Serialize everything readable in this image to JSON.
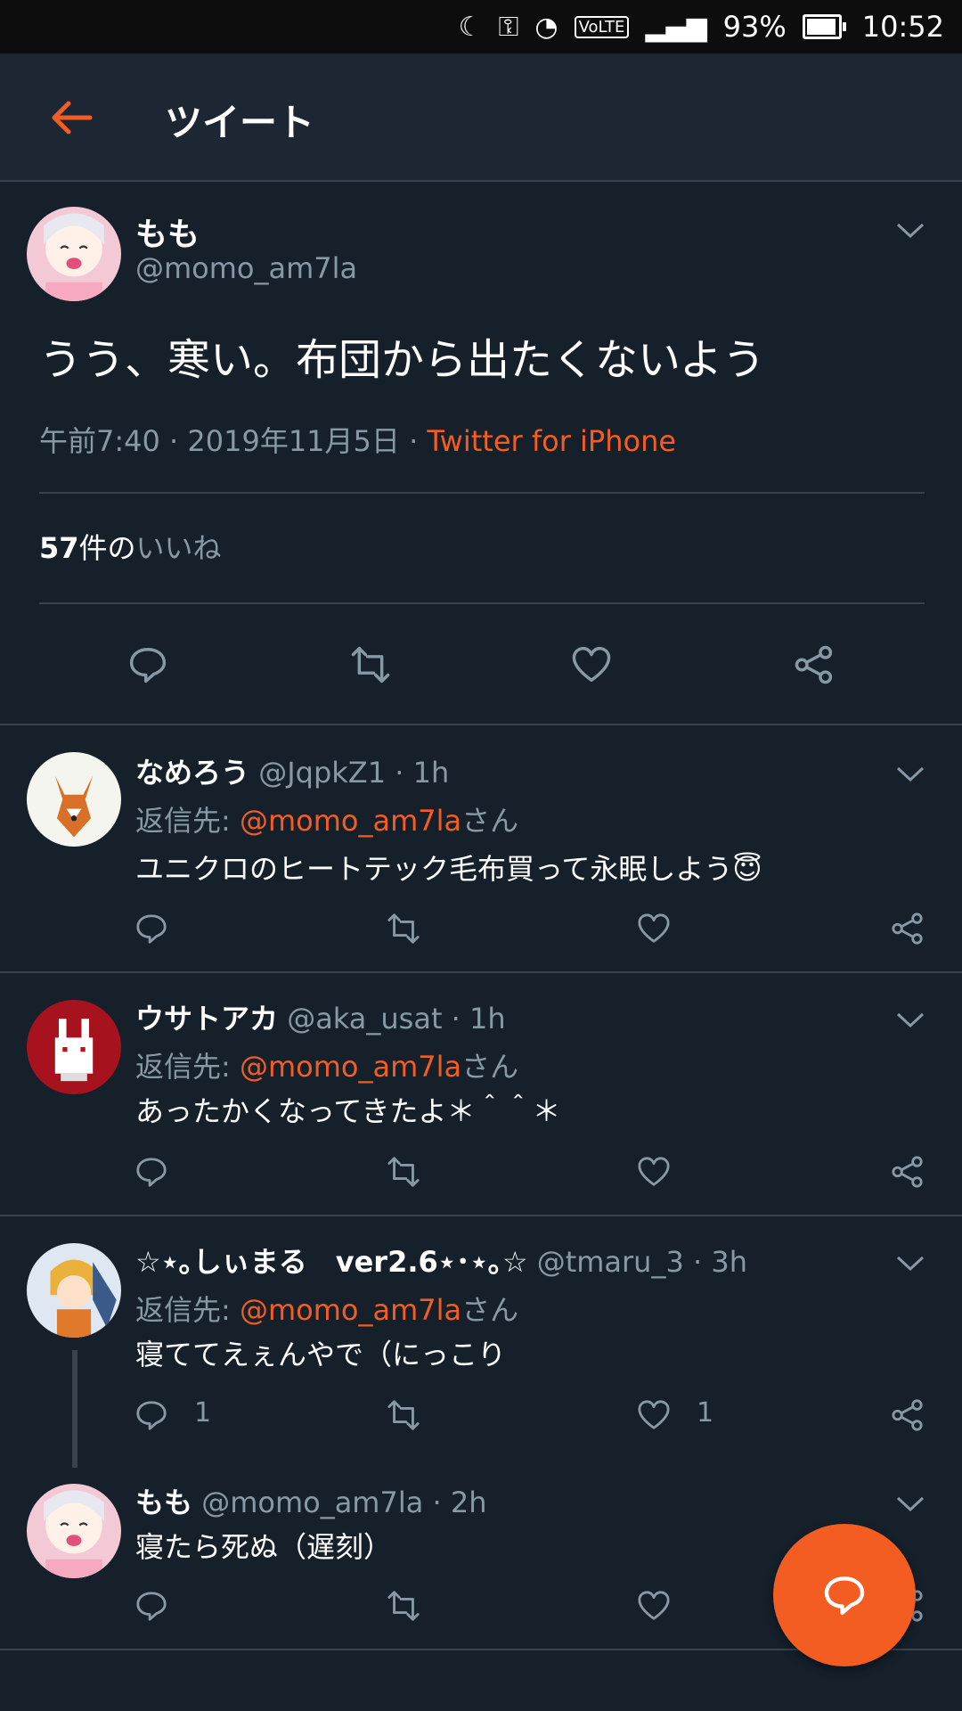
{
  "status_bar": {
    "battery": "93%",
    "time": "10:52"
  },
  "header": {
    "title": "ツイート"
  },
  "main_tweet": {
    "name": "もも",
    "handle": "@momo_am7la",
    "text": "うう、寒い。布団から出たくないよう",
    "time": "午前7:40 · 2019年11月5日 ·",
    "source": "Twitter for iPhone",
    "likes_count": "57",
    "likes_suffix": "件の",
    "likes_label": "いいね"
  },
  "replies": [
    {
      "name": "なめろう",
      "handle": "@JqpkZ1",
      "time": "1h",
      "reply_prefix": "返信先: ",
      "reply_to": "@momo_am7la",
      "reply_suffix": "さん",
      "text": "ユニクロのヒートテック毛布買って永眠しよう😇",
      "reply_count": "",
      "like_count": ""
    },
    {
      "name": "ウサトアカ",
      "handle": "@aka_usat",
      "time": "1h",
      "reply_prefix": "返信先: ",
      "reply_to": "@momo_am7la",
      "reply_suffix": "さん",
      "text": "あったかくなってきたよ＊＾＾＊",
      "reply_count": "",
      "like_count": ""
    },
    {
      "name": "☆⋆｡しぃまる　ver2.6⋆･⋆｡☆",
      "handle": "@tmaru_3",
      "time": "3h",
      "reply_prefix": "返信先: ",
      "reply_to": "@momo_am7la",
      "reply_suffix": "さん",
      "text": "寝ててえぇんやで（にっこり",
      "reply_count": "1",
      "like_count": "1"
    },
    {
      "name": "もも",
      "handle": "@momo_am7la",
      "time": "2h",
      "text": "寝たら死ぬ（遅刻）"
    }
  ],
  "icons": [
    "back-arrow-icon",
    "chevron-down-icon",
    "reply-icon",
    "retweet-icon",
    "like-icon",
    "share-icon",
    "compose-reply-icon"
  ],
  "colors": {
    "accent": "#f45d22",
    "background": "#15202b",
    "header": "#1c2733",
    "muted": "#8899a6",
    "divider": "#38444d"
  }
}
